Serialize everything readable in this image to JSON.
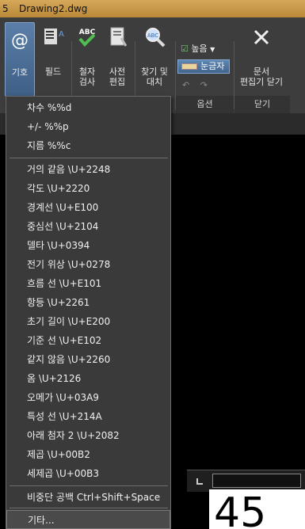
{
  "window": {
    "left_number": "5",
    "document_title": "Drawing2.dwg"
  },
  "ribbon": {
    "buttons": {
      "symbol": "기호",
      "field": "필드",
      "spell_check": [
        "철자",
        "검사"
      ],
      "dictionary": [
        "사전",
        "편집"
      ],
      "find_replace": [
        "찾기 및",
        "대치"
      ],
      "close_editor": [
        "문서",
        "편집기 닫기"
      ],
      "abc": "ABC"
    },
    "options": {
      "height_label": "높음",
      "ruler_label": "눈금자",
      "panel_title": "옵션"
    },
    "close_panel_title": "닫기"
  },
  "menu": {
    "group1": [
      "차수  %%d",
      "+/-  %%p",
      "지름  %%c"
    ],
    "group2": [
      "거의 같음  \\U+2248",
      "각도  \\U+2220",
      "경계선  \\U+E100",
      "중심선  \\U+2104",
      "델타  \\U+0394",
      "전기 위상  \\U+0278",
      "흐름 선  \\U+E101",
      "항등  \\U+2261",
      "초기 길이  \\U+E200",
      "기준 선  \\U+E102",
      "같지 않음  \\U+2260",
      "옴  \\U+2126",
      "오메가  \\U+03A9",
      "특성 선  \\U+214A",
      "아래 첨자 2  \\U+2082",
      "제곱  \\U+00B2",
      "세제곱  \\U+00B3"
    ],
    "group3": [
      "비중단 공백  Ctrl+Shift+Space"
    ],
    "other": "기타..."
  },
  "drawing": {
    "big_text": "45"
  },
  "colors": {
    "ribbon_bg": "#3d3d3d",
    "menu_bg": "#3a3a3a",
    "accent": "#4a6f99",
    "title_bar": "#c9974b"
  }
}
